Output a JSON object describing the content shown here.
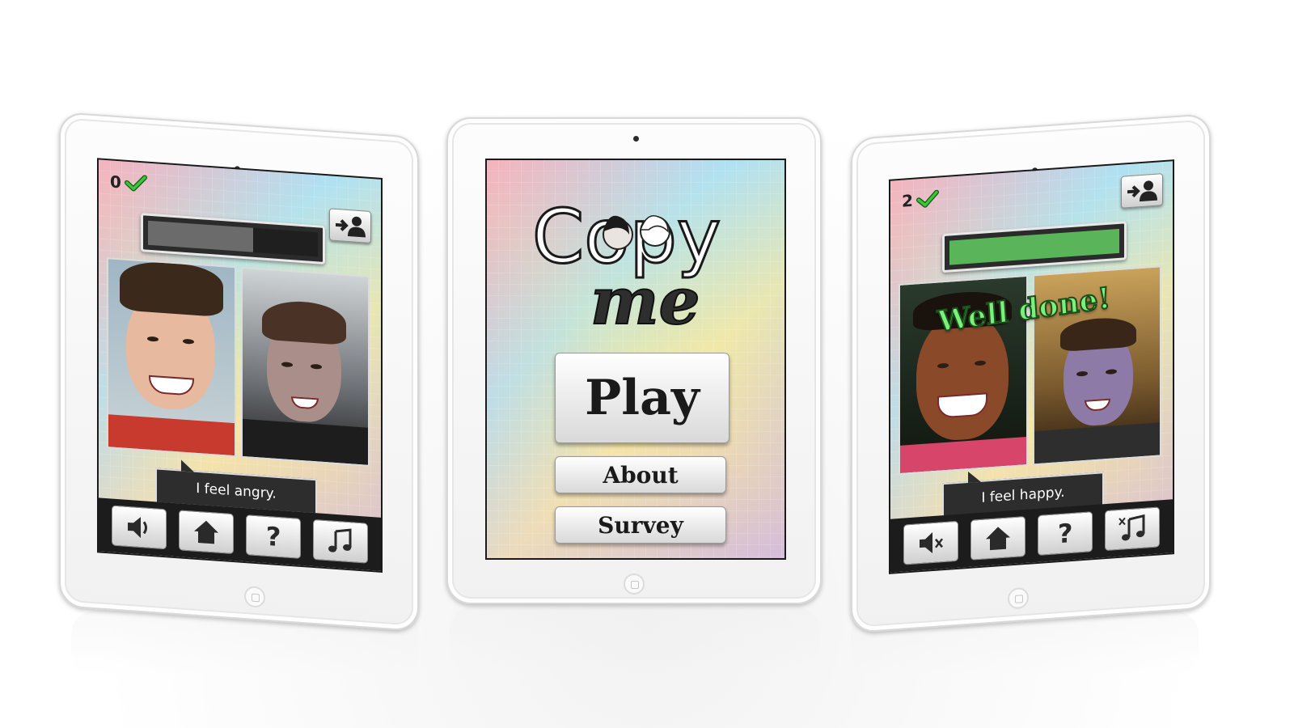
{
  "left_device": {
    "score": "0",
    "progress_fraction": 0.62,
    "progress_color": "#6b6b6b",
    "caption": "I feel angry.",
    "toolbar": [
      "speaker-icon",
      "home-icon",
      "?",
      "music-note-icon"
    ]
  },
  "center_device": {
    "logo_line1": "Copy",
    "logo_line2": "me",
    "play_label": "Play",
    "about_label": "About",
    "survey_label": "Survey"
  },
  "right_device": {
    "score": "2",
    "progress_fraction": 1.0,
    "progress_color": "#5ab55a",
    "overlay": "Well done!",
    "caption": "I feel happy.",
    "toolbar": [
      "speaker-muted-icon",
      "home-icon",
      "?",
      "music-muted-icon"
    ]
  },
  "colors": {
    "check_green": "#3cc43c",
    "caption_bg": "#2d2d2d"
  }
}
